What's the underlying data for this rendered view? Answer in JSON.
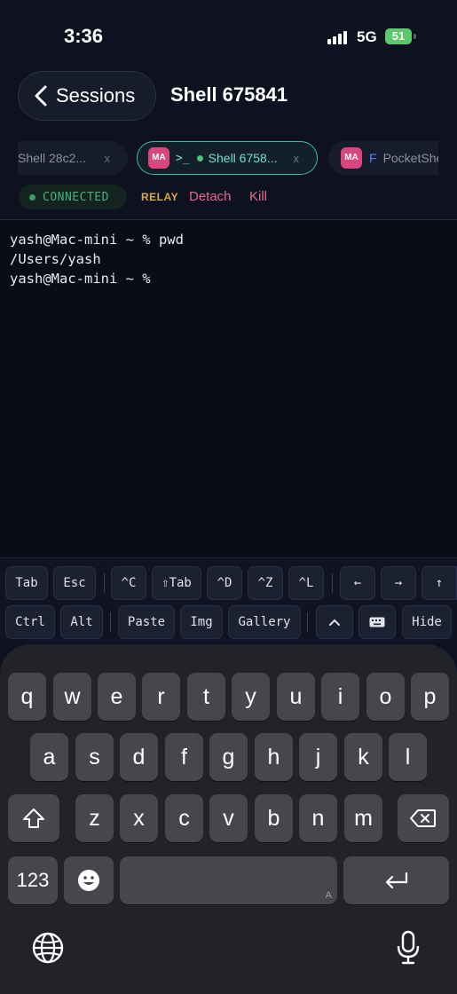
{
  "status_bar": {
    "time": "3:36",
    "network": "5G",
    "battery": "51"
  },
  "header": {
    "back_label": "Sessions",
    "title": "Shell 675841"
  },
  "tabs": [
    {
      "label": "Shell 28c2...",
      "close": "x"
    },
    {
      "avatar": "MA",
      "prompt": ">_",
      "label": "Shell 6758...",
      "close": "x",
      "active": true
    },
    {
      "avatar": "MA",
      "prefix": "F",
      "label": "PocketShe"
    }
  ],
  "session": {
    "state": "CONNECTED",
    "mode": "RELAY",
    "detach": "Detach",
    "kill": "Kill"
  },
  "terminal": {
    "lines": [
      "yash@Mac-mini ~ % pwd",
      "/Users/yash",
      "yash@Mac-mini ~ %"
    ]
  },
  "keybar": {
    "row1": [
      "Tab",
      "Esc",
      "^C",
      "⇧Tab",
      "^D",
      "^Z",
      "^L",
      "←",
      "→",
      "↑"
    ],
    "row2": [
      "Ctrl",
      "Alt",
      "Paste",
      "Img",
      "Gallery",
      "^",
      "keyboard-icon",
      "Hide"
    ]
  },
  "keyboard": {
    "row1": [
      "q",
      "w",
      "e",
      "r",
      "t",
      "y",
      "u",
      "i",
      "o",
      "p"
    ],
    "row2": [
      "a",
      "s",
      "d",
      "f",
      "g",
      "h",
      "j",
      "k",
      "l"
    ],
    "row3": [
      "z",
      "x",
      "c",
      "v",
      "b",
      "n",
      "m"
    ],
    "numbers": "123",
    "space_hint": "A",
    "icons": [
      "shift-icon",
      "backspace-icon",
      "emoji-icon",
      "return-icon",
      "globe-icon",
      "microphone-icon"
    ]
  },
  "colors": {
    "accent": "#3fb8a3",
    "connected": "#47b07a",
    "relay": "#d9a94a",
    "danger": "#e36a8a",
    "avatar": "#d9467f"
  }
}
